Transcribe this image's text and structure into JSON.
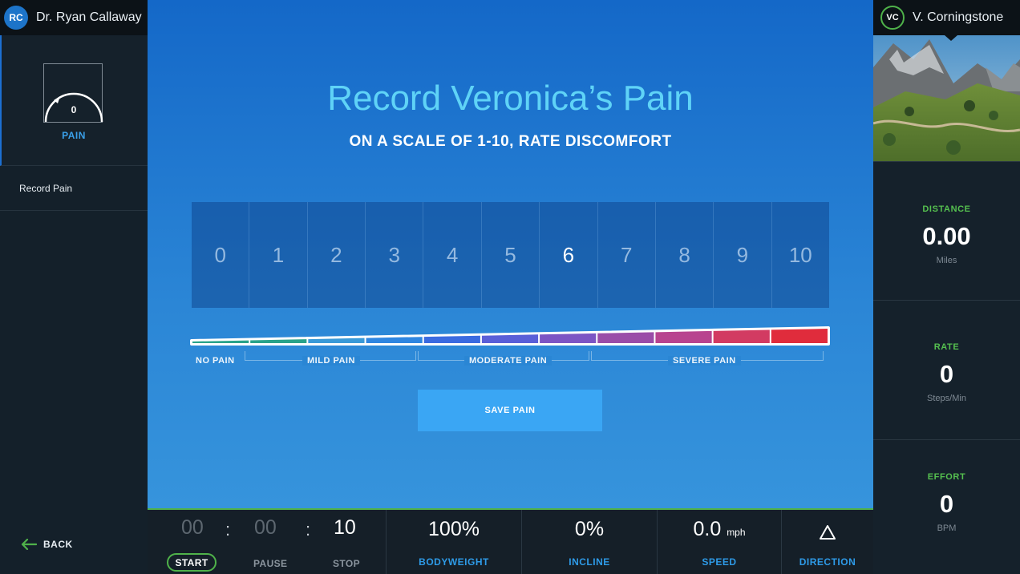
{
  "left_sidebar": {
    "user": {
      "initials": "RC",
      "name": "Dr. Ryan Callaway"
    },
    "pain_gauge": {
      "value": "0",
      "label": "PAIN"
    },
    "menu_item": "Record Pain",
    "back_label": "BACK"
  },
  "main": {
    "title": "Record Veronica’s Pain",
    "subtitle": "ON A SCALE OF 1-10, RATE DISCOMFORT",
    "scale": [
      "0",
      "1",
      "2",
      "3",
      "4",
      "5",
      "6",
      "7",
      "8",
      "9",
      "10"
    ],
    "selected_value": "6",
    "categories": {
      "no_pain": "NO PAIN",
      "mild_pain": "MILD PAIN",
      "moderate_pain": "MODERATE PAIN",
      "severe_pain": "SEVERE PAIN"
    },
    "save_label": "SAVE PAIN",
    "bar_colors": [
      "#2aa38a",
      "#2aa38a",
      "#3a9ad8",
      "#2f86e0",
      "#3b6be0",
      "#5a5fd8",
      "#7c55c4",
      "#9a4da8",
      "#b8448f",
      "#d23b62",
      "#e02c3c"
    ]
  },
  "bottom_bar": {
    "timer": {
      "hours": "00",
      "minutes": "00",
      "seconds": "10",
      "sep": ":"
    },
    "controls": {
      "start": "START",
      "pause": "PAUSE",
      "stop": "STOP"
    },
    "bodyweight": {
      "value": "100%",
      "label": "BODYWEIGHT"
    },
    "incline": {
      "value": "0%",
      "label": "INCLINE"
    },
    "speed": {
      "value": "0.0",
      "unit": "mph",
      "label": "SPEED"
    },
    "direction": {
      "label": "DIRECTION"
    }
  },
  "right_sidebar": {
    "user": {
      "initials": "VC",
      "name": "V. Corningstone"
    },
    "distance": {
      "label": "DISTANCE",
      "value": "0.00",
      "unit": "Miles"
    },
    "rate": {
      "label": "RATE",
      "value": "0",
      "unit": "Steps/Min"
    },
    "effort": {
      "label": "EFFORT",
      "value": "0",
      "unit": "BPM"
    }
  },
  "colors": {
    "accent_blue": "#3aa6f4",
    "accent_green": "#4fb24a",
    "title_cyan": "#5fd3f7"
  }
}
